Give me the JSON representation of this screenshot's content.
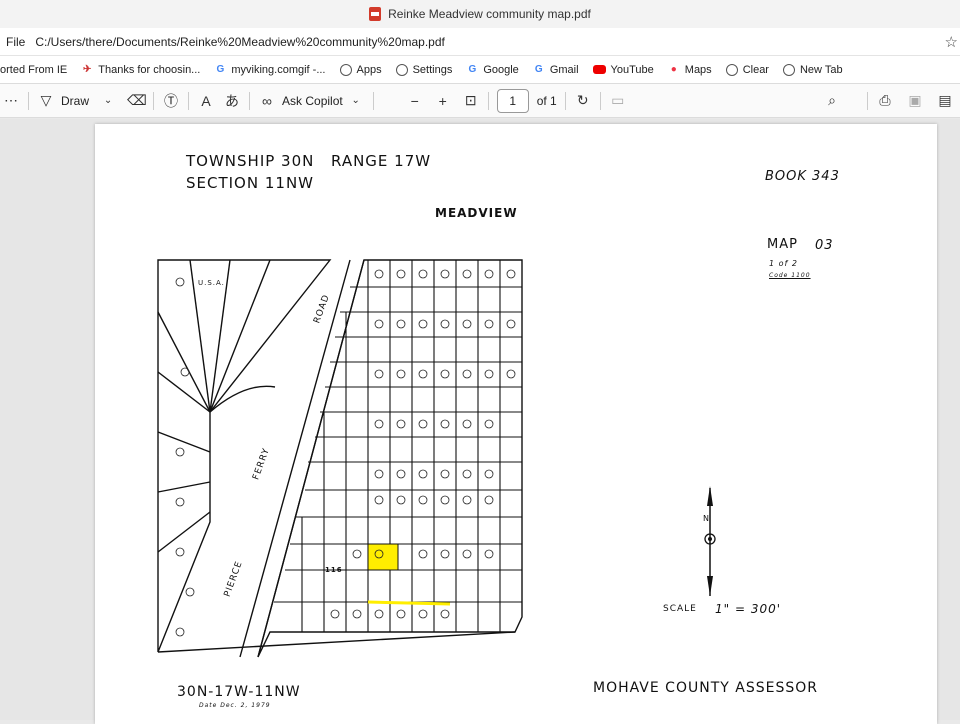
{
  "window": {
    "title": "Reinke Meadview community map.pdf"
  },
  "address_bar": {
    "label": "File",
    "url": "C:/Users/there/Documents/Reinke%20Meadview%20community%20map.pdf"
  },
  "bookmarks": [
    {
      "label": "orted From IE",
      "icon": "folder-icon"
    },
    {
      "label": "Thanks for choosin...",
      "icon": "bird-icon"
    },
    {
      "label": "myviking.comgif -...",
      "icon": "google-icon"
    },
    {
      "label": "Apps",
      "icon": "globe-icon"
    },
    {
      "label": "Settings",
      "icon": "globe-icon"
    },
    {
      "label": "Google",
      "icon": "google-icon"
    },
    {
      "label": "Gmail",
      "icon": "google-icon"
    },
    {
      "label": "YouTube",
      "icon": "youtube-icon"
    },
    {
      "label": "Maps",
      "icon": "maps-icon"
    },
    {
      "label": "Clear",
      "icon": "globe-icon"
    },
    {
      "label": "New Tab",
      "icon": "globe-icon"
    }
  ],
  "toolbar": {
    "draw_label": "Draw",
    "copilot_label": "Ask Copilot",
    "page_current": "1",
    "page_total": "of 1"
  },
  "map": {
    "township": "TOWNSHIP 30N",
    "range": "RANGE 17W",
    "section": "SECTION 11NW",
    "book": "BOOK 343",
    "community": "MEADVIEW",
    "map_label": "MAP",
    "map_number": "03",
    "sheet": "1 of 2",
    "code": "Code 1100",
    "road_1": "PIERCE",
    "road_2": "FERRY",
    "road_3": "ROAD",
    "scale_label": "SCALE",
    "scale_value": "1\" = 300'",
    "north": "N",
    "footer_left": "30N-17W-11NW",
    "footer_date": "Date Dec. 2, 1979",
    "footer_right": "MOHAVE COUNTY ASSESSOR",
    "usa_label": "U.S.A.",
    "highlight_lot": "116",
    "highlight_color": "#ffee00"
  }
}
